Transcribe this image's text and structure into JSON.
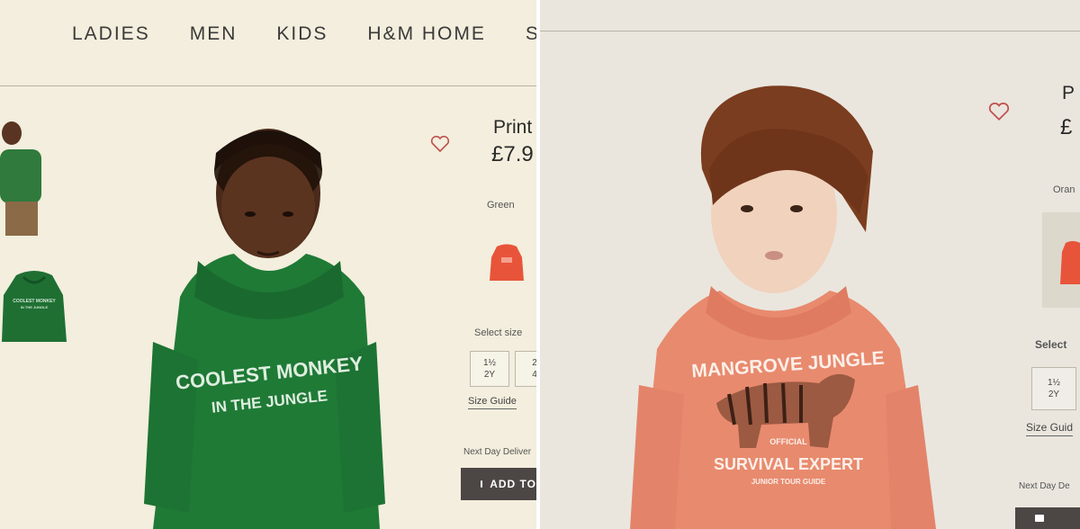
{
  "left": {
    "nav": [
      "LADIES",
      "MEN",
      "KIDS",
      "H&M HOME",
      "SA"
    ],
    "product_title": "Print",
    "price": "£7.9",
    "color_label": "Green",
    "select_size_label": "Select size",
    "sizes": [
      {
        "top": "1½",
        "bottom": "2Y"
      },
      {
        "top": "2",
        "bottom": "4"
      }
    ],
    "size_guide": "Size Guide",
    "delivery": "Next Day Deliver",
    "add_button": "ADD TO",
    "hoodie_print": {
      "line1": "COOLEST MONKEY",
      "line2": "IN THE JUNGLE"
    },
    "thumb_print": {
      "line1": "COOLEST MONKEY",
      "line2": "IN THE JUNGLE"
    },
    "colors": {
      "hoodie": "#1f7a36",
      "background": "#f3eedd",
      "swatch": "#e8543a"
    }
  },
  "right": {
    "product_title": "P",
    "price": "£",
    "color_label": "Oran",
    "select_size_label": "Select",
    "sizes": [
      {
        "top": "1½",
        "bottom": "2Y"
      }
    ],
    "size_guide": "Size Guid",
    "delivery": "Next Day De",
    "hoodie_print": {
      "line1": "MANGROVE JUNGLE",
      "line2": "OFFICIAL",
      "line3": "SURVIVAL EXPERT",
      "line4": "JUNIOR TOUR GUIDE"
    },
    "colors": {
      "hoodie": "#e88a6e",
      "background": "#eae6de",
      "swatch": "#e8543a"
    }
  }
}
